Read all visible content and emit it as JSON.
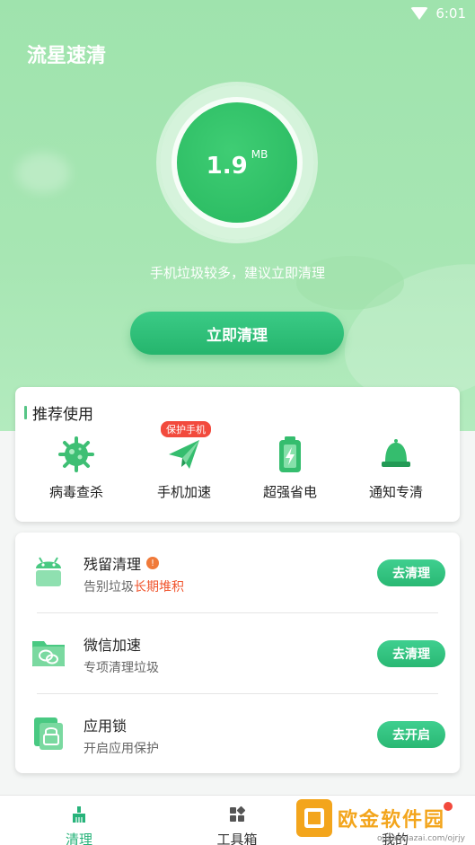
{
  "status_bar": {
    "time": "6:01",
    "wifi_icon": "wifi-icon"
  },
  "app": {
    "title": "流星速清"
  },
  "junk": {
    "value": "1.9",
    "unit": "MB",
    "hint": "手机垃圾较多，建议立即清理"
  },
  "clean_button": "立即清理",
  "recommend": {
    "title": "推荐使用",
    "items": [
      {
        "label": "病毒查杀",
        "icon": "virus-icon"
      },
      {
        "label": "手机加速",
        "icon": "paper-plane-icon",
        "badge": "保护手机"
      },
      {
        "label": "超强省电",
        "icon": "battery-icon"
      },
      {
        "label": "通知专清",
        "icon": "bell-icon"
      }
    ]
  },
  "features": [
    {
      "title": "残留清理",
      "subtitle": "告别垃圾",
      "subtitle_warn": "长期堆积",
      "button": "去清理",
      "icon": "android-icon",
      "alert": "!"
    },
    {
      "title": "微信加速",
      "subtitle": "专项清理垃圾",
      "button": "去清理",
      "icon": "wechat-folder-icon"
    },
    {
      "title": "应用锁",
      "subtitle": "开启应用保护",
      "button": "去开启",
      "icon": "lock-icon"
    }
  ],
  "tabs": [
    {
      "label": "清理",
      "icon": "broom-icon",
      "active": true
    },
    {
      "label": "工具箱",
      "icon": "toolbox-icon",
      "active": false
    },
    {
      "label": "我的",
      "icon": "profile-icon",
      "active": false
    }
  ],
  "watermark": {
    "text": "欧金软件园",
    "url": "ouyaoxiazai.com/ojrjy"
  },
  "colors": {
    "accent": "#27b56d",
    "hero": "#a3e5b0",
    "warn": "#f0542d",
    "badge": "#f24a3d"
  }
}
